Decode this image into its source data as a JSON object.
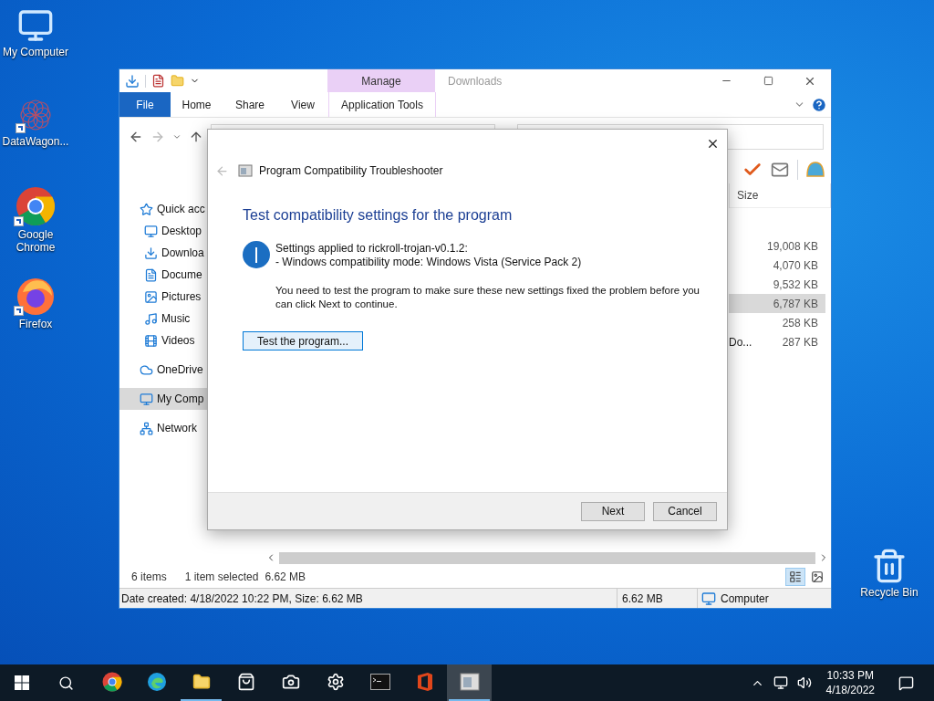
{
  "desktop_icons": [
    {
      "label": "My Computer"
    },
    {
      "label": "DataWagon..."
    },
    {
      "label": "Google Chrome"
    },
    {
      "label": "Firefox"
    },
    {
      "label": "Recycle Bin"
    }
  ],
  "explorer": {
    "title": "Downloads",
    "context_group": "Manage",
    "ribbon_tabs": [
      {
        "label": "File",
        "kind": "file"
      },
      {
        "label": "Home",
        "kind": "tab"
      },
      {
        "label": "Share",
        "kind": "tab"
      },
      {
        "label": "View",
        "kind": "tab"
      },
      {
        "label": "Application Tools",
        "kind": "context"
      }
    ],
    "nav": [
      {
        "label": "Quick acc",
        "selected": false,
        "children": [
          {
            "label": "Desktop",
            "selected": false
          },
          {
            "label": "Downloa",
            "selected": false
          },
          {
            "label": "Docume",
            "selected": false
          },
          {
            "label": "Pictures",
            "selected": false
          },
          {
            "label": "Music",
            "selected": false
          },
          {
            "label": "Videos",
            "selected": false
          }
        ]
      },
      {
        "label": "OneDrive",
        "selected": false
      },
      {
        "label": "My Comp",
        "selected": true
      },
      {
        "label": "Network",
        "selected": false
      }
    ],
    "column": "Size",
    "rows": [
      {
        "size": "19,008 KB",
        "selected": false
      },
      {
        "size": "4,070 KB",
        "selected": false
      },
      {
        "size": "9,532 KB",
        "selected": false
      },
      {
        "size": "6,787 KB",
        "selected": true
      },
      {
        "size": "258 KB",
        "selected": false
      },
      {
        "name": "Do...",
        "size": "287 KB",
        "selected": false
      }
    ],
    "status": {
      "count": "6 items",
      "selection": "1 item selected",
      "selection_size": "6.62 MB"
    },
    "details": {
      "text": "Date created: 4/18/2022 10:22 PM, Size: 6.62 MB",
      "size": "6.62 MB",
      "location": "Computer"
    }
  },
  "dialog": {
    "title": "Program Compatibility Troubleshooter",
    "heading": "Test compatibility settings for the program",
    "info_lines": [
      "Settings applied to rickroll-trojan-v0.1.2:",
      "- Windows compatibility mode: Windows Vista (Service Pack 2)"
    ],
    "note": "You need to test the program to make sure these new settings fixed the problem before you can click Next to continue.",
    "test_button": "Test the program...",
    "buttons": [
      "Next",
      "Cancel"
    ]
  },
  "taskbar": {
    "apps": [
      {
        "running": false,
        "selected": false
      },
      {
        "running": false,
        "selected": false
      },
      {
        "running": true,
        "selected": false
      },
      {
        "running": false,
        "selected": false
      },
      {
        "running": false,
        "selected": false
      },
      {
        "running": false,
        "selected": false
      },
      {
        "running": false,
        "selected": false
      },
      {
        "running": false,
        "selected": false
      },
      {
        "running": true,
        "selected": true
      }
    ],
    "time": "10:33 PM",
    "date": "4/18/2022"
  }
}
